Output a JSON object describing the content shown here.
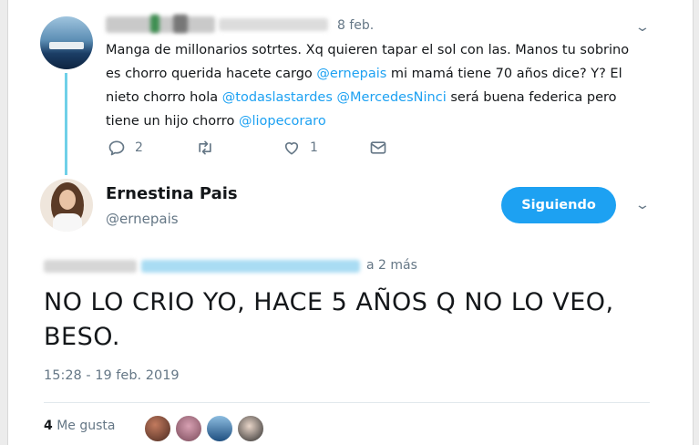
{
  "reply_tweet": {
    "date": "8 feb.",
    "text_parts": [
      {
        "text": "Manga de millonarios sotrtes. Xq quieren tapar el sol con las. Manos tu sobrino es chorro querida hacete cargo ",
        "mention": false
      },
      {
        "text": "@ernepais",
        "mention": true
      },
      {
        "text": " mi mamá tiene 70 años dice? Y? El nieto chorro hola ",
        "mention": false
      },
      {
        "text": "@todaslastardes",
        "mention": true
      },
      {
        "text": " ",
        "mention": false
      },
      {
        "text": "@MercedesNinci",
        "mention": true
      },
      {
        "text": "  será buena federica pero tiene un hijo chorro ",
        "mention": false
      },
      {
        "text": "@liopecoraro",
        "mention": true
      }
    ],
    "actions": {
      "reply_count": "2",
      "retweet_count": "",
      "like_count": "1"
    }
  },
  "main_tweet": {
    "author_name": "Ernestina Pais",
    "author_handle": "@ernepais",
    "follow_label": "Siguiendo",
    "reply_to_suffix": "a 2 más",
    "text": "NO LO CRIO YO, HACE 5 AÑOS Q NO LO VEO, BESO.",
    "timestamp": "15:28 - 19 feb. 2019",
    "likes_count": "4",
    "likes_label": "Me gusta"
  },
  "colors": {
    "accent": "#1da1f2",
    "muted": "#657786",
    "thread_line": "#6fd0e8"
  },
  "icons": [
    "reply-icon",
    "retweet-icon",
    "like-icon",
    "direct-message-icon",
    "chevron-down-icon"
  ]
}
